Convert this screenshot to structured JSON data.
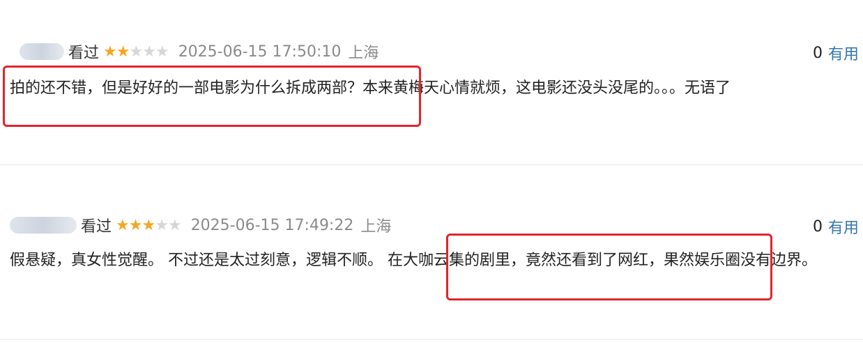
{
  "reviews": [
    {
      "status": "看过",
      "rating": 2,
      "max_rating": 5,
      "timestamp": "2025-06-15 17:50:10",
      "location": "上海",
      "useful_count": "0",
      "useful_label": "有用",
      "content": "拍的还不错，但是好好的一部电影为什么拆成两部？本来黄梅天心情就烦，这电影还没头没尾的。。。无语了"
    },
    {
      "status": "看过",
      "rating": 3,
      "max_rating": 5,
      "timestamp": "2025-06-15 17:49:22",
      "location": "上海",
      "useful_count": "0",
      "useful_label": "有用",
      "content": "假悬疑，真女性觉醒。 不过还是太过刻意，逻辑不顺。 在大咖云集的剧里，竟然还看到了网红，果然娱乐圈没有边界。"
    }
  ],
  "colors": {
    "highlight_border": "#e0252b",
    "star_on": "#f5a623",
    "star_off": "#d6d6d6",
    "link": "#3377aa",
    "meta_gray": "#8a8a8a"
  },
  "icons": {
    "star": "star-icon"
  }
}
